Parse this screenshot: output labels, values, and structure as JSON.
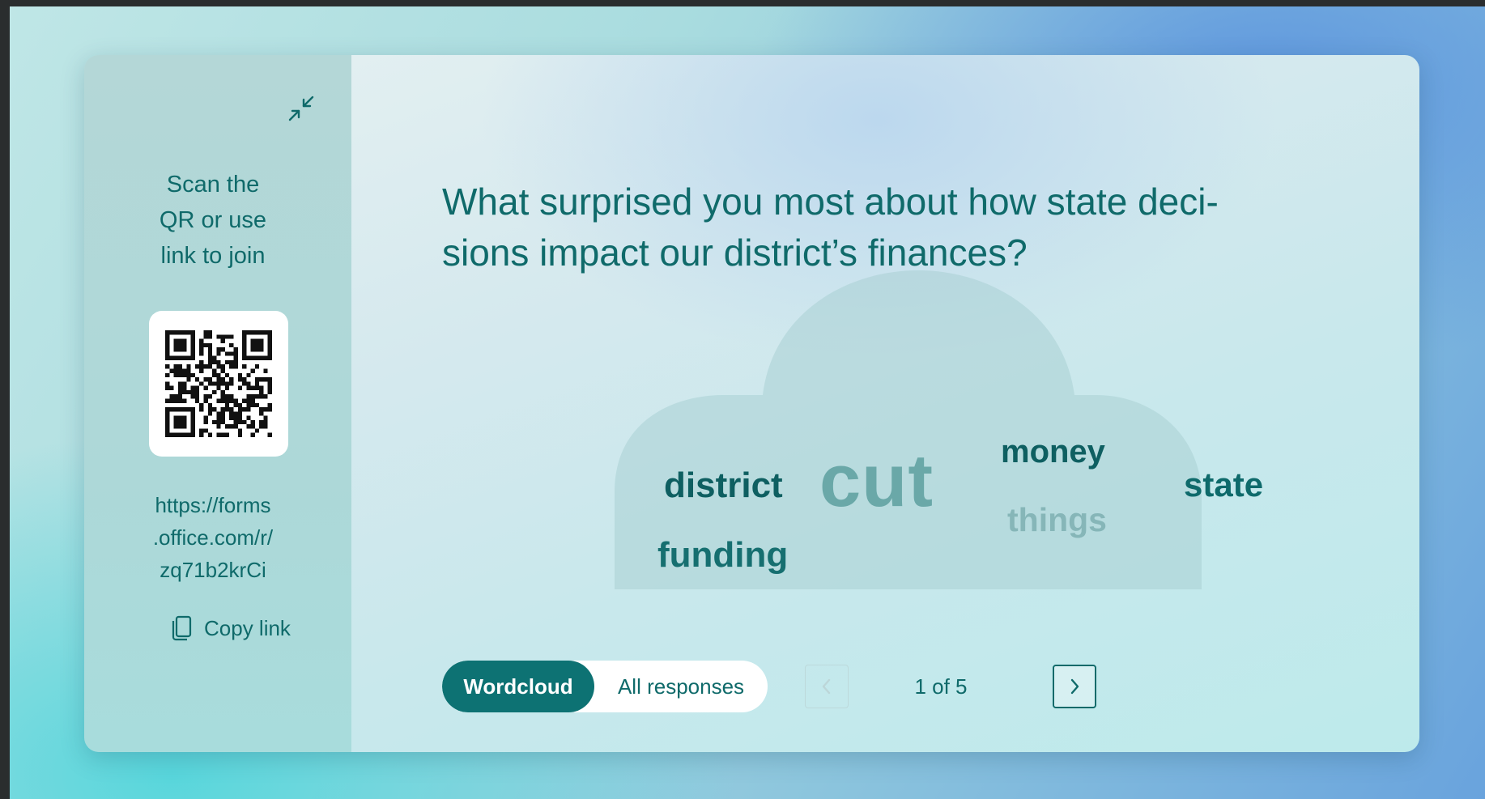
{
  "sidebar": {
    "collapse_icon": "collapse-arrows-icon",
    "scan_line1": "Scan the",
    "scan_line2": "QR or use",
    "scan_line3": "link to join",
    "qr_icon": "qr-code",
    "link_line1": "https://forms",
    "link_line2": ".office.com/r/",
    "link_line3": "zq71b2krCi",
    "copy_icon": "copy-icon",
    "copy_label": "Copy link"
  },
  "main": {
    "question_line1": "What surprised you most about how state deci-",
    "question_line2": "sions impact our district’s finances?",
    "wordcloud": {
      "words": [
        {
          "text": "cut",
          "color": "#6aa8a8"
        },
        {
          "text": "district",
          "color": "#0e5f61"
        },
        {
          "text": "money",
          "color": "#0e5f61"
        },
        {
          "text": "state",
          "color": "#0e6a6b"
        },
        {
          "text": "funding",
          "color": "#166f70"
        },
        {
          "text": "things",
          "color": "#86b6b8"
        }
      ]
    },
    "view_toggle": {
      "active_label": "Wordcloud",
      "inactive_label": "All responses"
    },
    "pager": {
      "text": "1 of 5",
      "prev_icon": "chevron-left-icon",
      "next_icon": "chevron-right-icon"
    }
  },
  "colors": {
    "accent": "#0d7273",
    "text_primary": "#0f6a6a",
    "cloud_fill": "#a9d0d4"
  }
}
